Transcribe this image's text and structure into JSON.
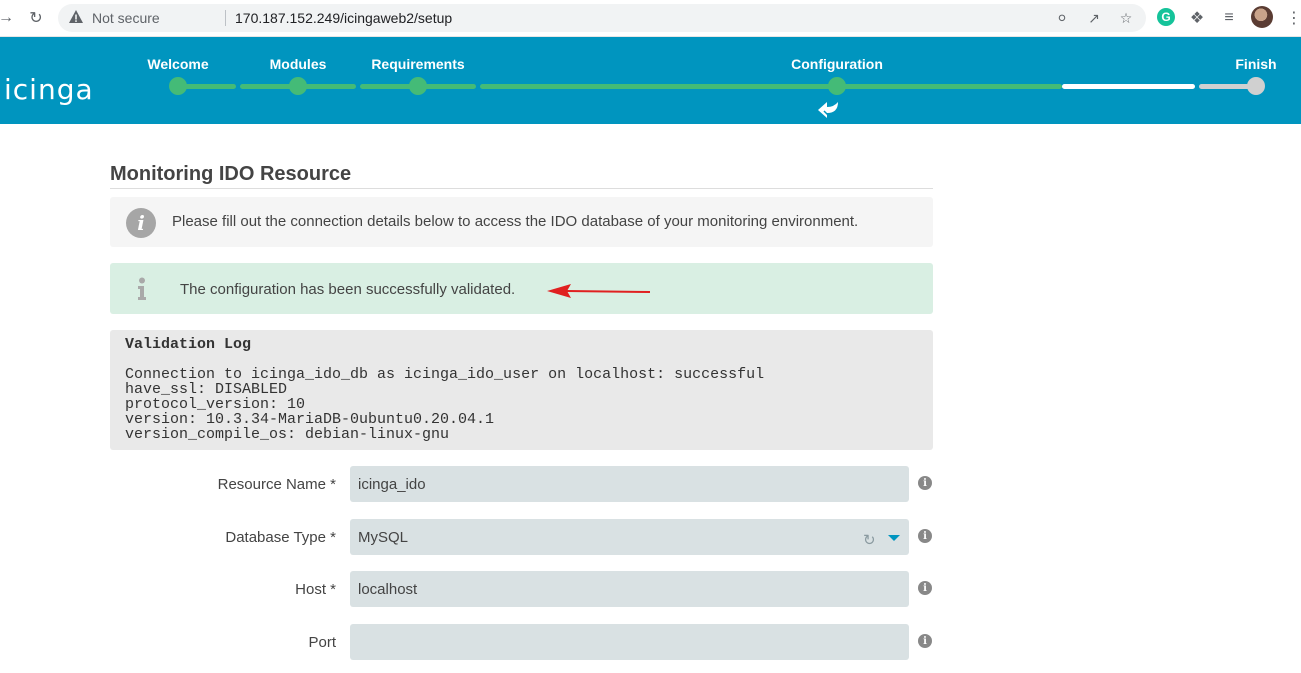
{
  "browser": {
    "security_label": "Not secure",
    "url": "170.187.152.249/icingaweb2/setup",
    "extension_badge": "G"
  },
  "header": {
    "logo": "icinga",
    "steps": [
      {
        "label": "Welcome",
        "state": "done"
      },
      {
        "label": "Modules",
        "state": "done"
      },
      {
        "label": "Requirements",
        "state": "done"
      },
      {
        "label": "Configuration",
        "state": "current"
      },
      {
        "label": "Finish",
        "state": "pending"
      }
    ]
  },
  "page": {
    "title": "Monitoring IDO Resource",
    "info_text": "Please fill out the connection details below to access the IDO database of your monitoring environment.",
    "success_text": "The configuration has been successfully validated."
  },
  "validation_log": {
    "title": "Validation Log",
    "lines": [
      "Connection to icinga_ido_db as icinga_ido_user on localhost: successful",
      "have_ssl: DISABLED",
      "protocol_version: 10",
      "version: 10.3.34-MariaDB-0ubuntu0.20.04.1",
      "version_compile_os: debian-linux-gnu"
    ]
  },
  "form": {
    "resource_name": {
      "label": "Resource Name *",
      "value": "icinga_ido"
    },
    "database_type": {
      "label": "Database Type *",
      "value": "MySQL"
    },
    "host": {
      "label": "Host *",
      "value": "localhost"
    },
    "port": {
      "label": "Port",
      "value": ""
    }
  },
  "colors": {
    "header_bg": "#0095bf",
    "progress_green": "#44bb77",
    "success_bg": "#d9efe3",
    "field_bg": "#d9e1e3",
    "annotation_arrow": "#e02020"
  },
  "icons": {
    "back": "arrow-left-icon",
    "forward": "arrow-right-icon",
    "reload": "reload-icon",
    "warning": "warning-icon",
    "key": "key-icon",
    "share": "share-icon",
    "star": "star-icon",
    "extensions": "puzzle-icon",
    "reading_list": "reading-list-icon",
    "menu": "kebab-menu-icon",
    "info": "info-icon",
    "success": "info-i-icon",
    "help": "help-icon",
    "refresh": "refresh-icon",
    "dropdown": "caret-down-icon",
    "step_back": "double-back-arrow-icon"
  }
}
